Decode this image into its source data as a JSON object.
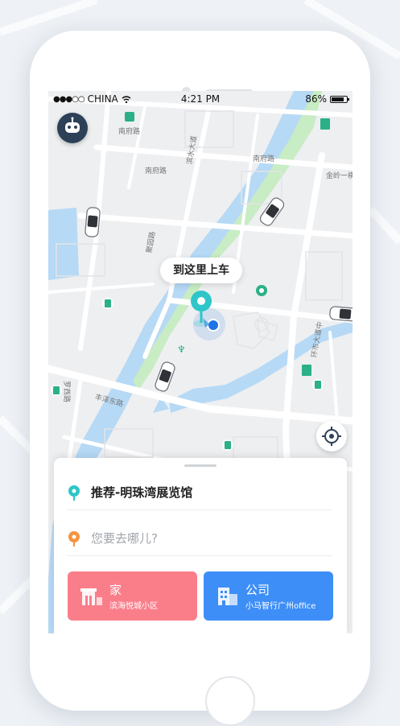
{
  "status_bar": {
    "carrier": "CHINA",
    "time": "4:21 PM",
    "battery_percent": "86%",
    "battery_level": 0.86
  },
  "map": {
    "pickup_label": "到这里上车",
    "roads": [
      "南府路",
      "南府路",
      "南府路",
      "滨水大道",
      "金岭一横",
      "聚园路",
      "罗西路",
      "丰泽东路",
      "环市大道中"
    ]
  },
  "trip": {
    "pickup_text": "推荐-明珠湾展览馆",
    "destination_placeholder": "您要去哪儿?"
  },
  "shortcuts": {
    "home": {
      "title": "家",
      "subtitle": "滨海悦城小区"
    },
    "office": {
      "title": "公司",
      "subtitle": "小马智行广州office"
    }
  },
  "colors": {
    "pickup_dot": "#2ec6c8",
    "destination_dot": "#f5933f",
    "home_card": "#fa7e8a",
    "office_card": "#3e8ef7",
    "river": "#b6d9f5",
    "park": "#c8ecc3"
  }
}
